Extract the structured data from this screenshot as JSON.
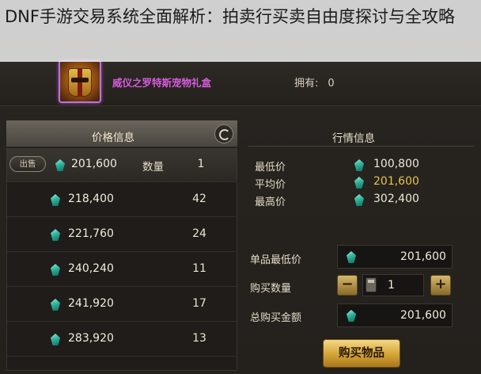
{
  "caption": {
    "title": "DNF手游交易系统全面解析：拍卖行买卖自由度探讨与全攻略"
  },
  "item": {
    "name": "威仪之罗特斯宠物礼盒",
    "own_label": "拥有:",
    "own_value": "0"
  },
  "price_panel": {
    "title": "价格信息",
    "sell_tag": "出售",
    "qty_header": "数量",
    "rows": [
      {
        "price": "201,600",
        "qty": "1"
      },
      {
        "price": "218,400",
        "qty": "42"
      },
      {
        "price": "221,760",
        "qty": "24"
      },
      {
        "price": "240,240",
        "qty": "11"
      },
      {
        "price": "241,920",
        "qty": "17"
      },
      {
        "price": "283,920",
        "qty": "13"
      }
    ]
  },
  "market": {
    "title": "行情信息",
    "lowest_label": "最低价",
    "lowest_value": "100,800",
    "avg_label": "平均价",
    "avg_value": "201,600",
    "highest_label": "最高价",
    "highest_value": "302,400"
  },
  "purchase": {
    "unit_min_label": "单品最低价",
    "unit_min_value": "201,600",
    "qty_label": "购买数量",
    "qty_value": "1",
    "minus": "−",
    "plus": "+",
    "total_label": "总购买金额",
    "total_value": "201,600",
    "buy_button": "购买物品"
  },
  "colors": {
    "item_name": "#d45cdc",
    "highlight_value": "#e9c24a",
    "gem": "#2fb39c",
    "buy_button": "#d6a83a"
  }
}
